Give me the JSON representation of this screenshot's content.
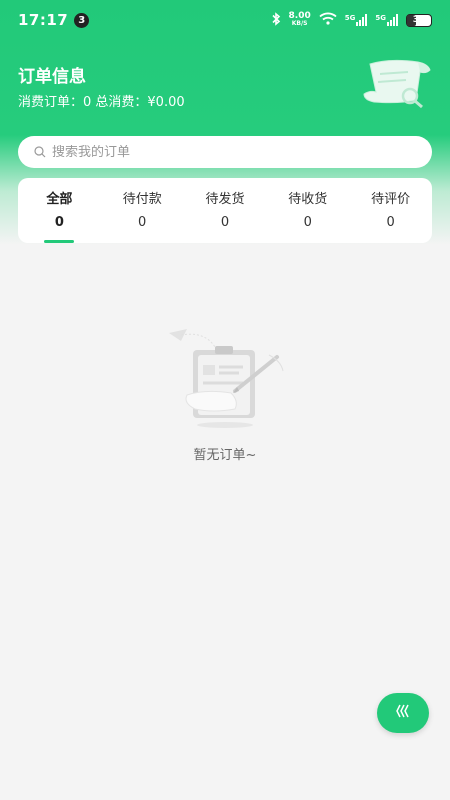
{
  "status_bar": {
    "time": "17:17",
    "notification_count": "3",
    "net_speed_value": "8.00",
    "net_speed_unit": "KB/S",
    "signal_1_label": "5G",
    "signal_2_label": "5G",
    "battery": "36"
  },
  "header": {
    "title": "订单信息",
    "summary": "消费订单：0 总消费：¥0.00"
  },
  "search": {
    "placeholder": "搜索我的订单"
  },
  "tabs": [
    {
      "label": "全部",
      "count": "0"
    },
    {
      "label": "待付款",
      "count": "0"
    },
    {
      "label": "待发货",
      "count": "0"
    },
    {
      "label": "待收货",
      "count": "0"
    },
    {
      "label": "待评价",
      "count": "0"
    }
  ],
  "empty_state": {
    "message": "暂无订单~"
  },
  "colors": {
    "accent": "#22c979",
    "background": "#f4f4f4"
  }
}
